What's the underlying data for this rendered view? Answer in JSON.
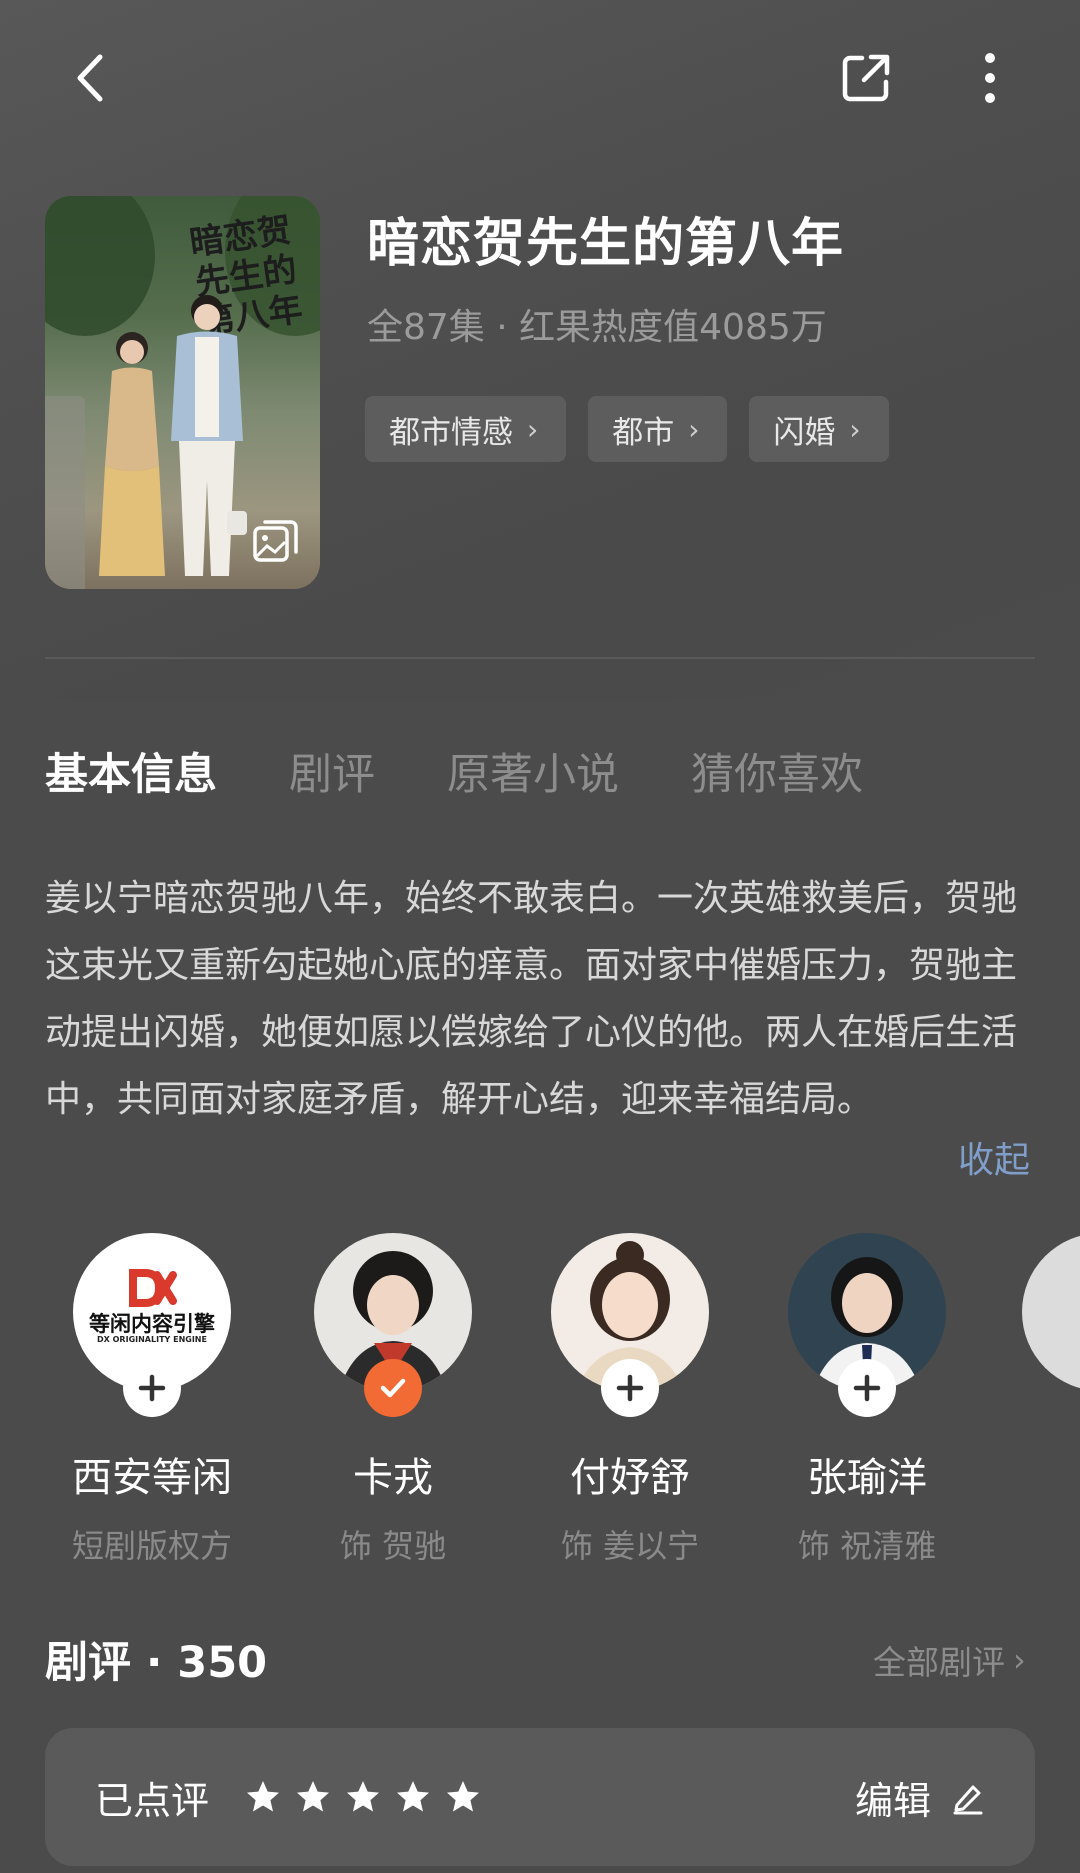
{
  "header": {
    "title": "暗恋贺先生的第八年",
    "meta": "全87集 · 红果热度值4085万",
    "poster_text": "暗恋贺先生的第八年",
    "tags": [
      {
        "label": "都市情感"
      },
      {
        "label": "都市"
      },
      {
        "label": "闪婚"
      }
    ]
  },
  "tabs": [
    "基本信息",
    "剧评",
    "原著小说",
    "猜你喜欢"
  ],
  "synopsis": {
    "text": "姜以宁暗恋贺驰八年，始终不敢表白。一次英雄救美后，贺驰这束光又重新勾起她心底的痒意。面对家中催婚压力，贺驰主动提出闪婚，她便如愿以偿嫁给了心仪的他。两人在婚后生活中，共同面对家庭矛盾，解开心结，迎来幸福结局。",
    "collapse_label": "收起"
  },
  "cast": [
    {
      "name": "西安等闲",
      "role": "短剧版权方",
      "logo_text": "等闲内容引擎",
      "logo_sub": "DX ORIGINALITY ENGINE",
      "followed": false
    },
    {
      "name": "卡戎",
      "role": "饰 贺驰",
      "followed": true
    },
    {
      "name": "付妤舒",
      "role": "饰 姜以宁",
      "followed": false
    },
    {
      "name": "张瑜洋",
      "role": "饰 祝清雅",
      "followed": false
    }
  ],
  "review": {
    "title": "剧评 · 350",
    "all_label": "全部剧评",
    "rated_label": "已点评",
    "stars": 5,
    "edit_label": "编辑"
  },
  "colors": {
    "background": "#4b4b4b",
    "accent_link": "#7f9ec9",
    "followed_badge": "#f26a34"
  }
}
